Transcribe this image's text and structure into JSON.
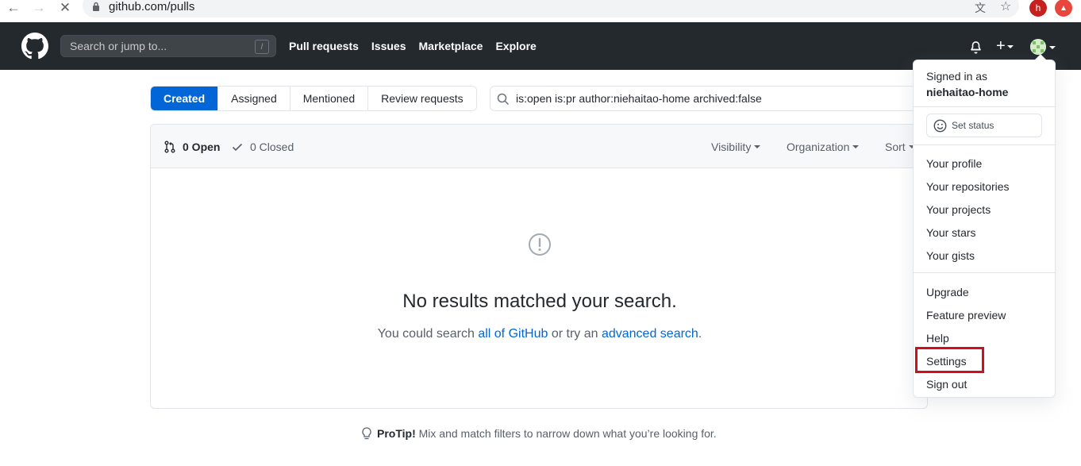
{
  "browser": {
    "url": "github.com/pulls",
    "profile_initial": "h"
  },
  "header": {
    "search_placeholder": "Search or jump to...",
    "search_shortcut": "/",
    "nav": [
      "Pull requests",
      "Issues",
      "Marketplace",
      "Explore"
    ],
    "plus_label": "+"
  },
  "tabs": [
    {
      "label": "Created",
      "active": true
    },
    {
      "label": "Assigned",
      "active": false
    },
    {
      "label": "Mentioned",
      "active": false
    },
    {
      "label": "Review requests",
      "active": false
    }
  ],
  "filter": {
    "value": "is:open is:pr author:niehaitao-home archived:false"
  },
  "states": {
    "open": "0 Open",
    "closed": "0 Closed"
  },
  "menus": [
    "Visibility",
    "Organization",
    "Sort"
  ],
  "blankslate": {
    "title": "No results matched your search.",
    "text_before": "You could search ",
    "link1": "all of GitHub",
    "text_middle": " or try an ",
    "link2": "advanced search",
    "text_after": "."
  },
  "protip": {
    "label": "ProTip!",
    "text": " Mix and match filters to narrow down what you’re looking for."
  },
  "dropdown": {
    "signed_in_as": "Signed in as",
    "username": "niehaitao-home",
    "set_status": "Set status",
    "group1": [
      "Your profile",
      "Your repositories",
      "Your projects",
      "Your stars",
      "Your gists"
    ],
    "group2": [
      "Upgrade",
      "Feature preview",
      "Help",
      "Settings",
      "Sign out"
    ]
  },
  "colors": {
    "header_bg": "#24292e",
    "accent": "#0366d6",
    "highlight": "#d10d1f"
  }
}
